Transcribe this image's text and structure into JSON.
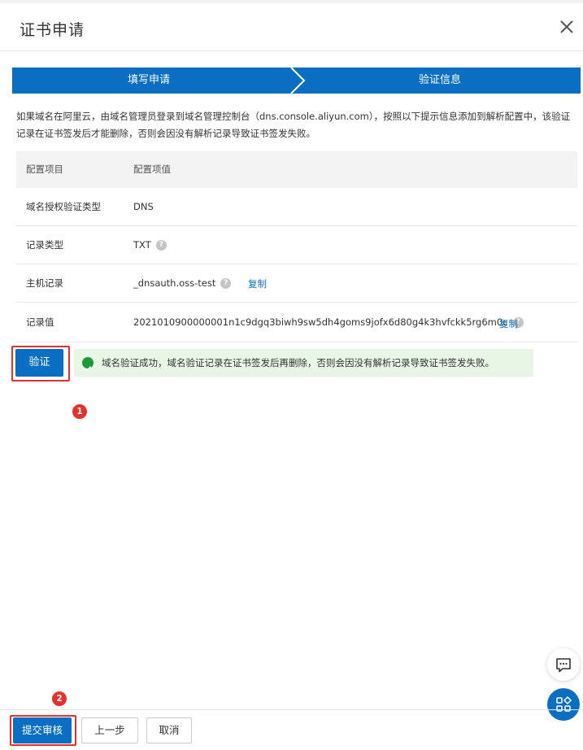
{
  "dialog": {
    "title": "证书申请",
    "close_icon": "close-icon"
  },
  "steps": [
    {
      "label": "填写申请"
    },
    {
      "label": "验证信息"
    }
  ],
  "info_text": "如果域名在阿里云，由域名管理员登录到域名管理控制台（dns.console.aliyun.com），按照以下提示信息添加到解析配置中，该验证记录在证书签发后才能删除，否则会因没有解析记录导致证书签发失败。",
  "table": {
    "headers": [
      "配置项目",
      "配置项值"
    ],
    "rows": [
      {
        "label": "域名授权验证类型",
        "value": "DNS"
      },
      {
        "label": "记录类型",
        "value": "TXT"
      },
      {
        "label": "主机记录",
        "value": "_dnsauth.oss-test",
        "action": "复制"
      },
      {
        "label": "记录值",
        "value": "2021010900000001n1c9dgq3biwh9sw5dh4goms9jofx6d80g4k3hvfckk5rg6m0c",
        "action": "复制"
      }
    ]
  },
  "verify": {
    "button_label": "验证",
    "success_message": "域名验证成功，域名验证记录在证书签发后再删除，否则会因没有解析记录导致证书签发失败。"
  },
  "badges": [
    "1",
    "2"
  ],
  "footer": {
    "submit_label": "提交审核",
    "prev_label": "上一步",
    "cancel_label": "取消"
  },
  "colors": {
    "primary": "#0a6fc2",
    "success": "#1f9a3a",
    "success_bg": "#e7f6e5",
    "highlight": "#e5302d"
  }
}
